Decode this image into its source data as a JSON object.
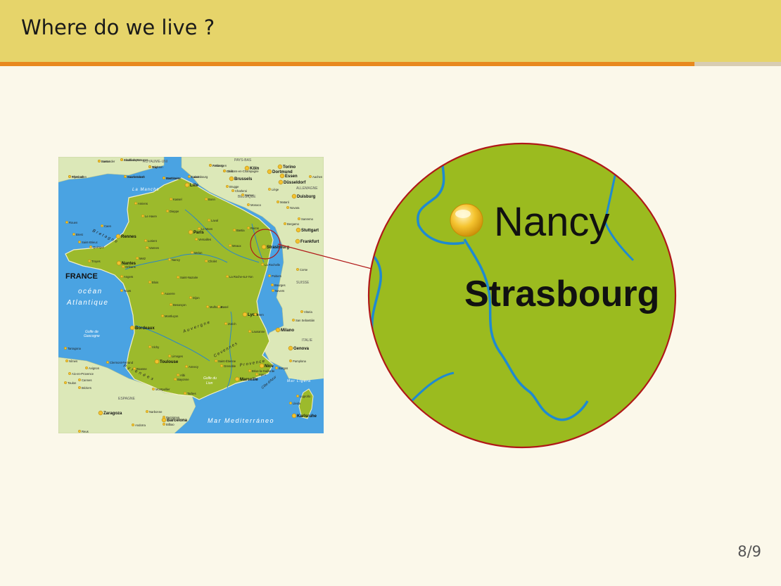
{
  "slide": {
    "title": "Where do we live ?",
    "page_number": "8/9",
    "progress_fraction": 0.889
  },
  "colors": {
    "header_background": "#e6d46a",
    "progress_fill": "#e8891e",
    "progress_track": "#d8cdb3",
    "slide_background": "#fbf8ea",
    "zoom_circle_border": "#b01818",
    "map_sea": "#4aa3e2",
    "map_france": "#9cba2c",
    "map_neighbors": "#dce8b8"
  },
  "map": {
    "country_label": "FRANCE",
    "ocean_label_1": "océan",
    "ocean_label_2": "Atlantique",
    "manche_label": "La Manche",
    "sea_label": "Mar Mediterráneo",
    "gulf_label_1": "Golfe de",
    "gulf_label_2": "Gascogne",
    "gulf_lion_1": "Golfe du",
    "gulf_lion_2": "Lion",
    "ligure_label": "Mar Ligura",
    "cote_azur": "Côte d'Azur",
    "countries": [
      "ESPAGNE",
      "ITALIE",
      "SUISSE",
      "ALLEMAGNE",
      "BELGIQUE",
      "ROYAUME-UNI",
      "PAYS-BAS"
    ],
    "regions": [
      "Bretagne",
      "Pyrénées",
      "Auvergne",
      "Provence",
      "Cevennes"
    ],
    "cities_major": [
      "Paris",
      "Strasbourg",
      "Nantes",
      "Toulouse",
      "Marseille",
      "Nice",
      "Bordeaux",
      "Lyon",
      "Rennes",
      "Lille",
      "Brussels",
      "Barcelona",
      "Zaragoza",
      "Genova",
      "Milano",
      "Torino",
      "Dortmund",
      "Essen",
      "Düsseldorf",
      "Köln",
      "Duisburg",
      "Frankfurt",
      "Stuttgart",
      "Karlsruhe",
      "Ajaccio"
    ],
    "cities_minor": [
      "Exeter",
      "Southampton",
      "Brighton",
      "Plymouth",
      "Bournemouth",
      "Eastbourne",
      "Calais",
      "Gent",
      "Antwerpen",
      "Brugge",
      "Charleroi",
      "Namur",
      "Liège",
      "Aachen",
      "Bonn",
      "Kassel",
      "Amiens",
      "Dieppe",
      "Le Havre",
      "Rouen",
      "Caen",
      "Brest",
      "Saint-Brieuc",
      "Quimper",
      "Lorient",
      "Vannes",
      "Laval",
      "Le Mans",
      "Versailles",
      "Reims",
      "Meaux",
      "Melun",
      "Metz",
      "Nancy",
      "Troyes",
      "Orléans",
      "Angers",
      "Tours",
      "Blois",
      "Saint-Nazaire",
      "Cholet",
      "La Roche-sur-Yon",
      "La Rochelle",
      "Poitiers",
      "Bourges",
      "Nevers",
      "Auxerre",
      "Dijon",
      "Besançon",
      "Mulhouse",
      "Basel",
      "Bern",
      "Zürich",
      "Lausanne",
      "Montluçon",
      "Vichy",
      "Limoges",
      "Clermont-Ferrand",
      "Roanne",
      "Annecy",
      "Saint-Étienne",
      "Grenoble",
      "Brive-la-Gaillarde",
      "Agen",
      "Albi",
      "Bayonne",
      "Tarbes",
      "Montpellier",
      "Nîmes",
      "Avignon",
      "Aix-en-Provence",
      "Cannes",
      "Toulon",
      "Béziers",
      "Narbonne",
      "Perpignan",
      "Andorra",
      "Bilbao",
      "San Sebastián",
      "Vitoria",
      "Pamplona",
      "Burgos",
      "Logroño",
      "Lleida",
      "Tarragona",
      "Reus",
      "Mataró",
      "Novara",
      "Bergamo",
      "Sanremo",
      "Monaco",
      "Bastia",
      "Corse",
      "Santander",
      "Alcalá de Henares",
      "Trier",
      "Wiesbaden",
      "Saarbrücken",
      "Mannheim",
      "Luxembourg",
      "Châlons-en-Champagne",
      "Freiburg"
    ],
    "highlight_city": "Nancy"
  },
  "zoom": {
    "city_1": "Nancy",
    "city_2": "Strasbourg"
  }
}
